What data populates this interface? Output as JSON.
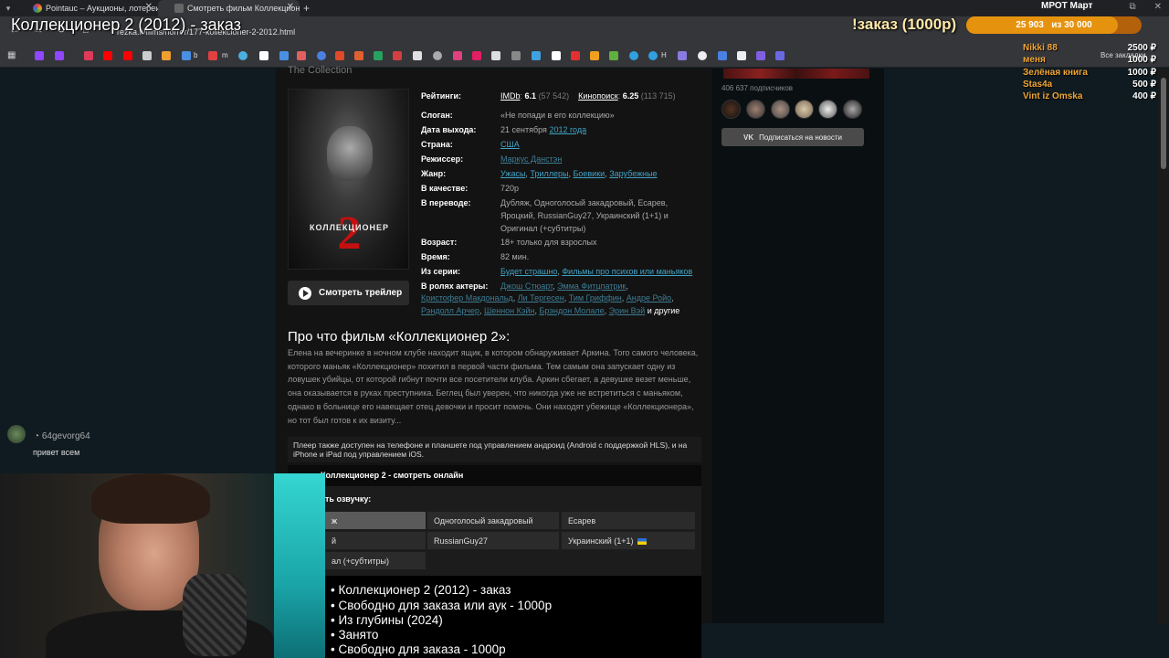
{
  "browser": {
    "tabs": [
      {
        "label": "Pointauc – Аукционы, лотереи",
        "color": "#e0a030"
      },
      {
        "label": "Смотреть фильм Коллекционер",
        "color": "#666"
      }
    ],
    "new_tab": "+",
    "url": "rezka.fi/films/horror/177-kollekcioner-2-2012.html",
    "bookmarks_all": "Все закладки",
    "bookmark_labels": {
      "b": "b",
      "m": "m",
      "h": "H"
    }
  },
  "overlay": {
    "stream_title": "Коллекционер 2 (2012) - заказ",
    "donate_title": "!заказ (1000р)",
    "goal": {
      "label": "МРОТ Март",
      "current": "25 903",
      "target": "из 30 000",
      "progress": 0.8634
    },
    "donors": [
      {
        "name": "Nikki 88",
        "amount": "2500 ₽"
      },
      {
        "name": "меня",
        "amount": "1000 ₽"
      },
      {
        "name": "Зелёная книга",
        "amount": "1000 ₽"
      },
      {
        "name": "Stas4a",
        "amount": "500 ₽"
      },
      {
        "name": "Vint iz Omska",
        "amount": "400 ₽"
      }
    ],
    "chat": {
      "user": "64gevorg64",
      "message": "привет всем"
    },
    "now_playing": [
      "• Коллекционер 2 (2012) - заказ",
      "• Свободно для заказа или аук - 1000р",
      "• Из глубины (2024)",
      "• Занято",
      "• Свободно для заказа - 1000р"
    ]
  },
  "film": {
    "original_title": "The Collection",
    "poster": {
      "label": "КОЛЛЕКЦИОНЕР",
      "number": "2"
    },
    "trailer_button": "Смотреть трейлер",
    "labels": {
      "ratings": "Рейтинги:",
      "slogan": "Слоган:",
      "release": "Дата выхода:",
      "country": "Страна:",
      "director": "Режиссер:",
      "genre": "Жанр:",
      "quality": "В качестве:",
      "translation": "В переводе:",
      "age": "Возраст:",
      "time": "Время:",
      "series": "Из серии:",
      "cast": "В ролях актеры:"
    },
    "ratings": {
      "imdb_label": "IMDb",
      "imdb_value": "6.1",
      "imdb_votes": "(57 542)",
      "kp_label": "Кинопоиск",
      "kp_value": "6.25",
      "kp_votes": "(113 715)"
    },
    "slogan": "«Не попади в его коллекцию»",
    "release_day": "21 сентября",
    "release_year": "2012 года",
    "country": "США",
    "director": "Маркус Данстэн",
    "genres": [
      "Ужасы",
      "Триллеры",
      "Боевики",
      "Зарубежные"
    ],
    "quality": "720p",
    "translation": "Дубляж, Одноголосый закадровый, Есарев, Яроцкий, RussianGuy27, Украинский (1+1) и Оригинал (+субтитры)",
    "age_value": "18+",
    "age_text": "только для взрослых",
    "time": "82 мин.",
    "series": [
      "Будет страшно",
      "Фильмы про психов или маньяков"
    ],
    "cast": [
      "Джош Стюарт",
      "Эмма Фитцпатрик",
      "Кристофер Макдональд",
      "Ли Тергесен",
      "Тим Гриффин",
      "Андре Ройо",
      "Рэндолл Арчер",
      "Шеннон Кэйн",
      "Брэндон Молале",
      "Эрин Вэй"
    ],
    "cast_more": "и другие",
    "about_title": "Про что фильм «Коллекционер 2»:",
    "about_text": "Елена на вечеринке в ночном клубе находит ящик, в котором обнаруживает Аркина. Того самого человека, которого маньяк «Коллекционер» похитил в первой части фильма. Тем самым она запускает одну из ловушек убийцы, от которой гибнут почти все посетители клуба. Аркин сбегает, а девушке везет меньше, она оказывается в руках преступника. Беглец был уверен, что никогда уже не встретиться с маньяком, однако в больнице его навещает отец девочки и просит помочь. Они находят убежище «Коллекционера», но тот был готов к их визиту..."
  },
  "player": {
    "note": "Плеер также доступен на телефоне и планшете под управлением андроид (Android с поддержкой HLS), и на iPhone и iPad под управлением iOS.",
    "header": "Коллекционер 2 - смотреть онлайн",
    "voice_label": "ть озвучку:",
    "voices": [
      {
        "label": "ж",
        "active": true
      },
      {
        "label": "Одноголосый закадровый",
        "active": false
      },
      {
        "label": "Есарев",
        "active": false
      },
      {
        "label": "й",
        "active": false
      },
      {
        "label": "RussianGuy27",
        "active": false
      },
      {
        "label": "Украинский (1+1)",
        "active": false
      },
      {
        "label": "ал (+субтитры)",
        "active": false
      }
    ]
  },
  "sidebar": {
    "subscribers": "406 637 подписчиков",
    "vk_icon": "VK",
    "vk_button": "Подписаться на новости"
  }
}
